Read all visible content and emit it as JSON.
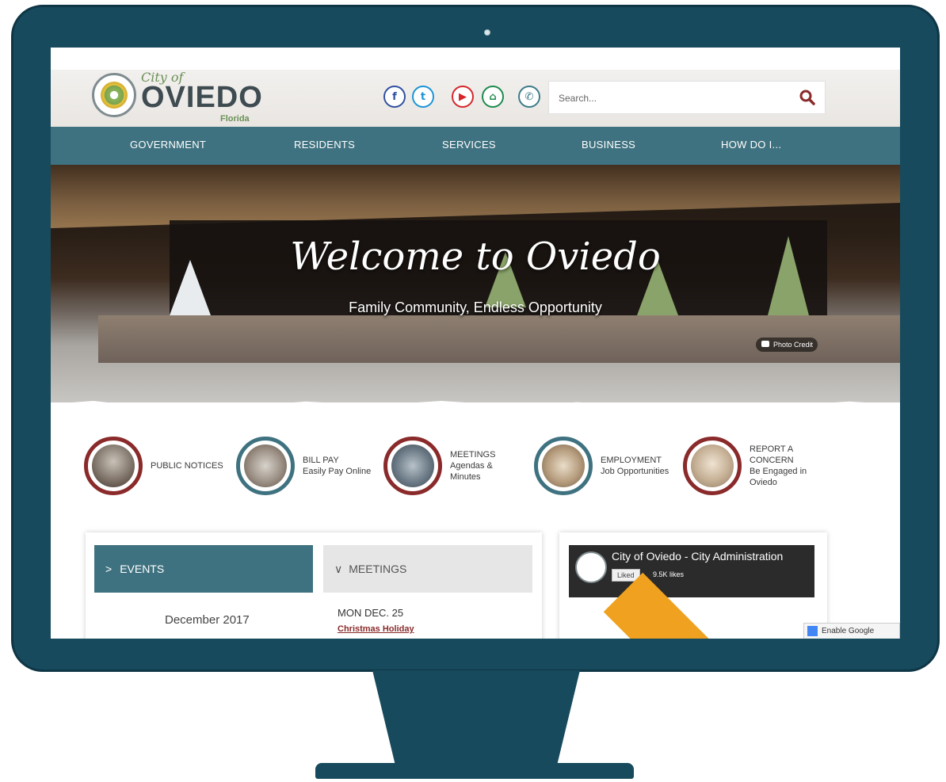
{
  "logo": {
    "line1": "City of",
    "name": "OVIEDO",
    "state": "Florida"
  },
  "social": {
    "facebook": "f",
    "twitter": "t",
    "youtube": "▶",
    "nextdoor": "⌂",
    "phone": "✆"
  },
  "search": {
    "placeholder": "Search..."
  },
  "nav": [
    "GOVERNMENT",
    "RESIDENTS",
    "SERVICES",
    "BUSINESS",
    "HOW DO I..."
  ],
  "hero": {
    "title": "Welcome to Oviedo",
    "subtitle": "Family Community, Endless Opportunity",
    "photo_credit": "Photo Credit"
  },
  "quick_links": [
    {
      "title": "PUBLIC NOTICES",
      "sub": ""
    },
    {
      "title": "BILL PAY",
      "sub": "Easily Pay Online"
    },
    {
      "title": "MEETINGS",
      "sub": "Agendas & Minutes"
    },
    {
      "title": "EMPLOYMENT",
      "sub": "Job Opportunities"
    },
    {
      "title": "REPORT A CONCERN",
      "sub": "Be Engaged in Oviedo"
    }
  ],
  "tabs": {
    "events": "EVENTS",
    "meetings": "MEETINGS"
  },
  "calendar": {
    "month": "December 2017"
  },
  "meeting": {
    "date": "MON DEC. 25",
    "title": "Christmas Holiday"
  },
  "facebook": {
    "page_name": "City of Oviedo - City Administration",
    "liked": "Liked",
    "likes": "9.5K likes"
  },
  "translate": "Enable Google Transla",
  "colors": {
    "frame": "#174a5c",
    "nav": "#3f7280",
    "accent_red": "#8a2a2a"
  }
}
